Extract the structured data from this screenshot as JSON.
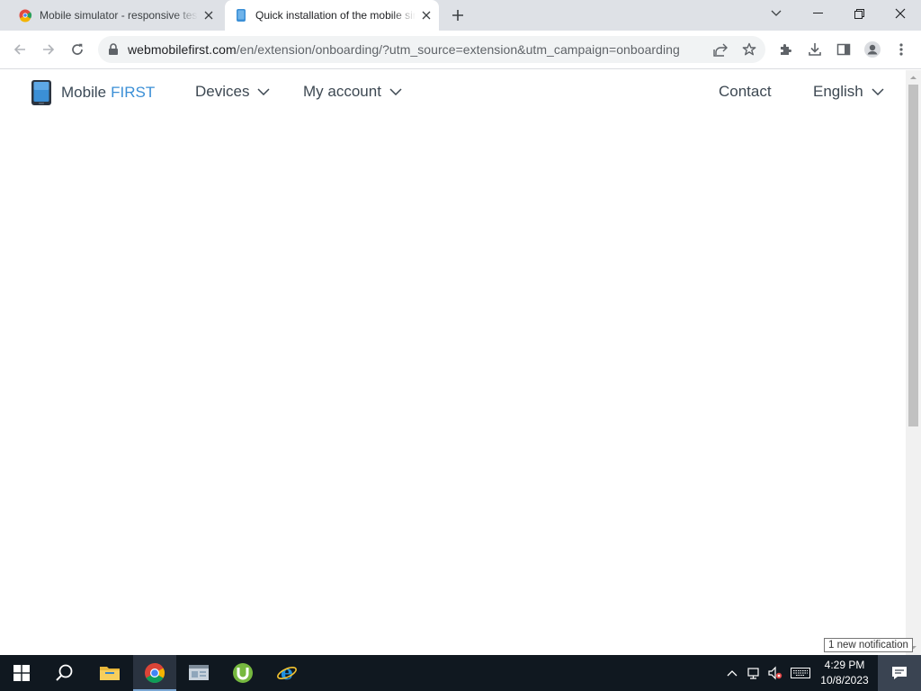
{
  "browser": {
    "tabs": [
      {
        "title": "Mobile simulator - responsive testing",
        "favicon": "chrome-extension-favicon-icon",
        "active": false
      },
      {
        "title": "Quick installation of the mobile simulator",
        "favicon": "mobile-first-favicon-icon",
        "active": true
      }
    ],
    "url": {
      "domain": "webmobilefirst.com",
      "path": "/en/extension/onboarding/?utm_source=extension&utm_campaign=onboarding"
    }
  },
  "site": {
    "logo": {
      "word1": "Mobile",
      "word2": "FIRST"
    },
    "nav": {
      "devices": "Devices",
      "account": "My account",
      "contact": "Contact",
      "language": "English"
    }
  },
  "taskbar": {
    "clock": {
      "time": "4:29 PM",
      "date": "10/8/2023"
    },
    "notification": "1 new notification"
  },
  "colors": {
    "brand_blue": "#3b8fd6",
    "nav_text": "#3d4852",
    "taskbar_bg": "#101820",
    "tabstrip_bg": "#dee1e6"
  }
}
